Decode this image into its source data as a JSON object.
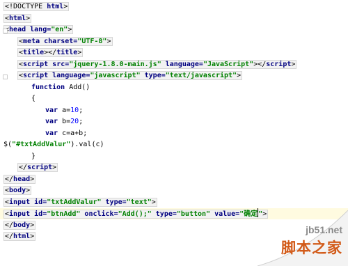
{
  "code_lines": [
    {
      "tokens": [
        {
          "t": "<!DOCTYPE ",
          "c": "tag-open"
        },
        {
          "t": "html",
          "c": "tn"
        },
        {
          "t": ">",
          "c": "tag-close"
        }
      ]
    },
    {
      "tokens": [
        {
          "t": "<",
          "c": "tag-open"
        },
        {
          "t": "html",
          "c": "tn"
        },
        {
          "t": ">",
          "c": "tag-close"
        }
      ]
    },
    {
      "tokens": [
        {
          "t": "<",
          "c": "tag-open"
        },
        {
          "t": "head",
          "c": "tn"
        },
        {
          "t": " lang=",
          "c": "an"
        },
        {
          "t": "\"en\"",
          "c": "av"
        },
        {
          "t": ">",
          "c": "tag-close"
        }
      ]
    },
    {
      "indent": 2,
      "tokens": [
        {
          "t": "<",
          "c": "tag-open"
        },
        {
          "t": "meta",
          "c": "tn"
        },
        {
          "t": " charset=",
          "c": "an"
        },
        {
          "t": "\"UTF-8\"",
          "c": "av"
        },
        {
          "t": ">",
          "c": "tag-close"
        }
      ]
    },
    {
      "indent": 2,
      "tokens": [
        {
          "t": "<",
          "c": "tag-open"
        },
        {
          "t": "title",
          "c": "tn"
        },
        {
          "t": "></",
          "c": "tag-mid"
        },
        {
          "t": "title",
          "c": "tn"
        },
        {
          "t": ">",
          "c": "tag-close"
        }
      ]
    },
    {
      "indent": 2,
      "tokens": [
        {
          "t": "<",
          "c": "tag-open"
        },
        {
          "t": "script",
          "c": "tn"
        },
        {
          "t": " src=",
          "c": "an"
        },
        {
          "t": "\"jquery-1.8.0-main.js\"",
          "c": "av"
        },
        {
          "t": " language=",
          "c": "an"
        },
        {
          "t": "\"JavaScript\"",
          "c": "av"
        },
        {
          "t": "></",
          "c": "tag-mid"
        },
        {
          "t": "script",
          "c": "tn"
        },
        {
          "t": ">",
          "c": "tag-close"
        }
      ]
    },
    {
      "indent": 2,
      "tokens": [
        {
          "t": "<",
          "c": "tag-open"
        },
        {
          "t": "script",
          "c": "tn"
        },
        {
          "t": " language=",
          "c": "an"
        },
        {
          "t": "\"javascript\"",
          "c": "av"
        },
        {
          "t": " type=",
          "c": "an"
        },
        {
          "t": "\"text/javascript\"",
          "c": "av"
        },
        {
          "t": ">",
          "c": "tag-close"
        }
      ]
    },
    {
      "indent": 4,
      "tokens": [
        {
          "t": "function ",
          "c": "kw"
        },
        {
          "t": "Add()",
          "c": "plain"
        }
      ]
    },
    {
      "indent": 4,
      "tokens": [
        {
          "t": "{",
          "c": "plain"
        }
      ]
    },
    {
      "indent": 6,
      "tokens": [
        {
          "t": "var ",
          "c": "kw"
        },
        {
          "t": "a=",
          "c": "plain"
        },
        {
          "t": "10",
          "c": "num"
        },
        {
          "t": ";",
          "c": "plain"
        }
      ]
    },
    {
      "indent": 6,
      "tokens": [
        {
          "t": "var ",
          "c": "kw"
        },
        {
          "t": "b=",
          "c": "plain"
        },
        {
          "t": "20",
          "c": "num"
        },
        {
          "t": ";",
          "c": "plain"
        }
      ]
    },
    {
      "indent": 6,
      "tokens": [
        {
          "t": "var ",
          "c": "kw"
        },
        {
          "t": "c=a+b;",
          "c": "plain"
        }
      ]
    },
    {
      "indent": 0,
      "tokens": [
        {
          "t": "$(",
          "c": "plain"
        },
        {
          "t": "\"#txtAddValur\"",
          "c": "str"
        },
        {
          "t": ").val(c)",
          "c": "plain"
        }
      ]
    },
    {
      "indent": 4,
      "tokens": [
        {
          "t": "}",
          "c": "plain"
        }
      ]
    },
    {
      "indent": 2,
      "tokens": [
        {
          "t": "</",
          "c": "tag-open"
        },
        {
          "t": "script",
          "c": "tn"
        },
        {
          "t": ">",
          "c": "tag-close"
        }
      ]
    },
    {
      "tokens": [
        {
          "t": "</",
          "c": "tag-open"
        },
        {
          "t": "head",
          "c": "tn"
        },
        {
          "t": ">",
          "c": "tag-close"
        }
      ]
    },
    {
      "tokens": [
        {
          "t": "<",
          "c": "tag-open"
        },
        {
          "t": "body",
          "c": "tn"
        },
        {
          "t": ">",
          "c": "tag-close"
        }
      ]
    },
    {
      "tokens": [
        {
          "t": "<",
          "c": "tag-open"
        },
        {
          "t": "input",
          "c": "tn"
        },
        {
          "t": " id=",
          "c": "an"
        },
        {
          "t": "\"txtAddValur\"",
          "c": "av"
        },
        {
          "t": " type=",
          "c": "an"
        },
        {
          "t": "\"text\"",
          "c": "av"
        },
        {
          "t": ">",
          "c": "tag-close"
        }
      ]
    },
    {
      "current": true,
      "tokens": [
        {
          "t": "<",
          "c": "tag-open"
        },
        {
          "t": "input",
          "c": "tn"
        },
        {
          "t": " id=",
          "c": "an"
        },
        {
          "t": "\"btnAdd\"",
          "c": "av"
        },
        {
          "t": " onclick=",
          "c": "an"
        },
        {
          "t": "\"Add();\"",
          "c": "av"
        },
        {
          "t": " type=",
          "c": "an"
        },
        {
          "t": "\"button\"",
          "c": "av"
        },
        {
          "t": " value=",
          "c": "an"
        },
        {
          "t": "\"确定",
          "c": "av"
        },
        {
          "t": "",
          "c": "caret"
        },
        {
          "t": "\"",
          "c": "av"
        },
        {
          "t": ">",
          "c": "tag-close"
        }
      ]
    },
    {
      "tokens": [
        {
          "t": "</",
          "c": "tag-open"
        },
        {
          "t": "body",
          "c": "tn"
        },
        {
          "t": ">",
          "c": "tag-close"
        }
      ]
    },
    {
      "tokens": [
        {
          "t": "</",
          "c": "tag-open"
        },
        {
          "t": "html",
          "c": "tn"
        },
        {
          "t": ">",
          "c": "tag-close"
        }
      ]
    }
  ],
  "watermark": {
    "domain": "jb51.net",
    "site": "脚本之家"
  },
  "colors": {
    "tag_name": "#000080",
    "attr_value": "#008000",
    "number": "#0000ff",
    "current_line": "#fffbe0",
    "watermark_orange": "#d25a18"
  }
}
